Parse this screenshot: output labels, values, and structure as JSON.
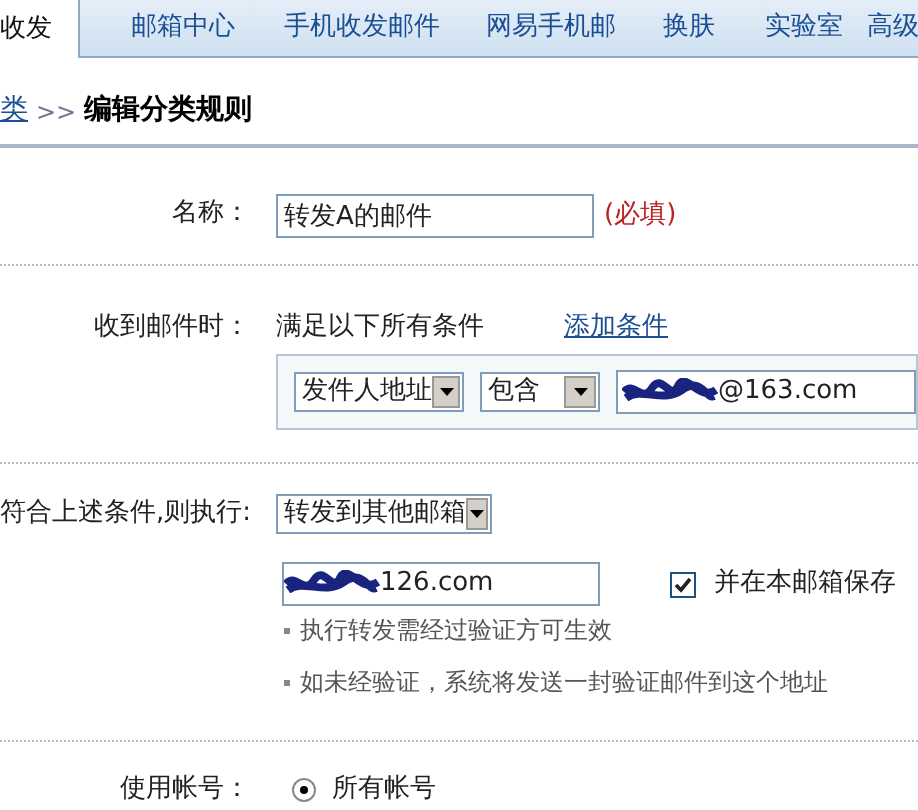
{
  "tabs": [
    {
      "label": "收发",
      "selected": true
    },
    {
      "label": "邮箱中心",
      "selected": false
    },
    {
      "label": "手机收发邮件",
      "selected": false
    },
    {
      "label": "网易手机邮",
      "selected": false
    },
    {
      "label": "换肤",
      "selected": false
    },
    {
      "label": "实验室",
      "selected": false
    },
    {
      "label": "高级",
      "selected": false
    }
  ],
  "breadcrumb": {
    "link": "类",
    "separator": ">>",
    "title": "编辑分类规则"
  },
  "name_row": {
    "label": "名称：",
    "value": "转发A的邮件",
    "required_note": "(必填)"
  },
  "conditions_row": {
    "label": "收到邮件时：",
    "description": "满足以下所有条件",
    "add_link": "添加条件",
    "conditions": [
      {
        "field": "发件人地址",
        "operator": "包含",
        "value": "@163.com",
        "redacted": true
      }
    ]
  },
  "action_row": {
    "label": "符合上述条件,则执行:",
    "action": "转发到其他邮箱",
    "forward_address": "126.com",
    "forward_redacted": true,
    "keep_copy": {
      "label": "并在本邮箱保存",
      "checked": true
    },
    "hints": [
      "执行转发需经过验证方可生效",
      "如未经验证，系统将发送一封验证邮件到这个地址"
    ]
  },
  "account_row": {
    "label": "使用帐号：",
    "options": [
      {
        "label": "所有帐号",
        "selected": true
      }
    ]
  }
}
